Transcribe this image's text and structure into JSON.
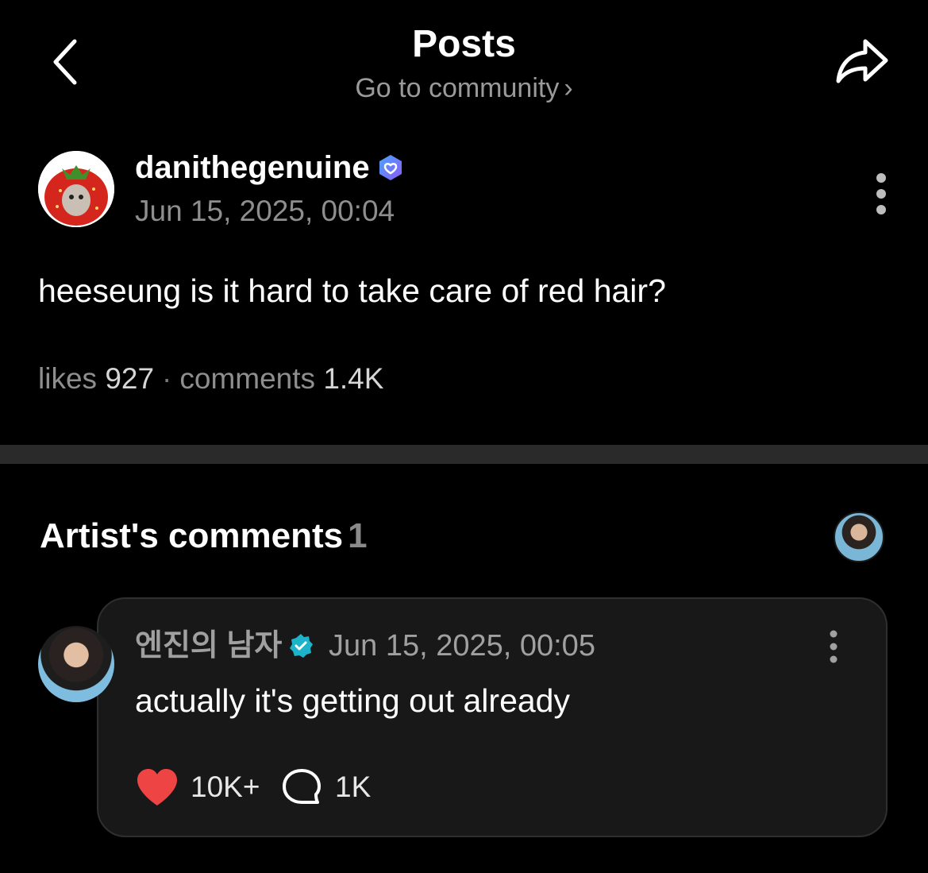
{
  "header": {
    "title": "Posts",
    "community_link": "Go to community",
    "chevron": "›",
    "back_icon": "chevron-left-icon",
    "share_icon": "share-arrow-icon"
  },
  "post": {
    "author": "danithegenuine",
    "author_badge": "verified-hexagon-icon",
    "timestamp": "Jun 15, 2025, 00:04",
    "body": "heeseung is it hard to take care of red hair?",
    "likes_label": "likes",
    "likes_count": "927",
    "separator": "·",
    "comments_label": "comments",
    "comments_count": "1.4K"
  },
  "artist_comments": {
    "title": "Artist's comments",
    "count": "1",
    "comment": {
      "author": "엔진의 남자",
      "author_badge": "verified-round-icon",
      "timestamp": "Jun 15, 2025, 00:05",
      "text": "actually it's getting out already",
      "likes": "10K+",
      "replies": "1K"
    }
  },
  "colors": {
    "background": "#000000",
    "muted_text": "#8e8e8e",
    "badge_purple": "#7b5cff",
    "badge_teal": "#1db3c9",
    "heart": "#ef4444"
  }
}
